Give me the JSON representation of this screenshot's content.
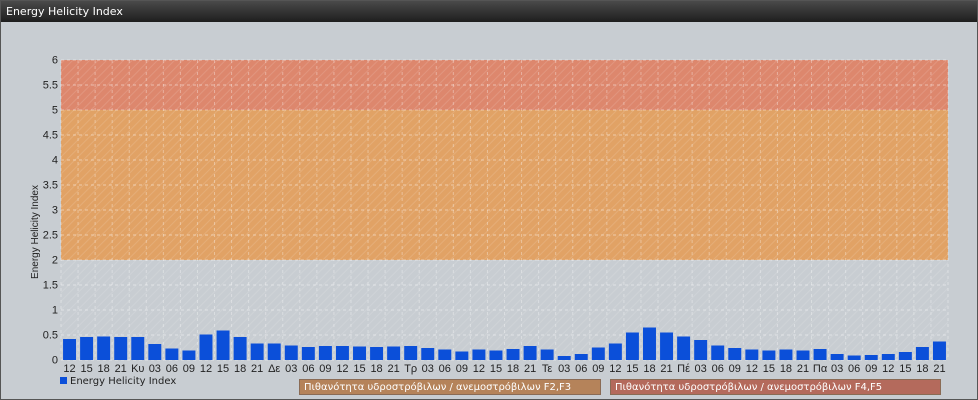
{
  "window": {
    "title": "Energy Helicity Index"
  },
  "legend": {
    "series_label": "Energy Helicity Index",
    "series_color": "#0b4fd9"
  },
  "bands": [
    {
      "from": 2,
      "to": 5,
      "label": "Πιθανότητα υδροστρόβιλων / ανεμοστρόβιλων F2,F3",
      "color": "#e59a52",
      "label_color": "#b5835a"
    },
    {
      "from": 5,
      "to": 6,
      "label": "Πιθανότητα υδροστρόβιλων / ανεμοστρόβιλων F4,F5",
      "color": "#e07a5c",
      "label_color": "#b46a5c"
    }
  ],
  "chart_data": {
    "type": "bar",
    "ylabel": "Energy Helicity Index",
    "ylim": [
      0,
      6
    ],
    "yticks": [
      0,
      0.5,
      1,
      1.5,
      2,
      2.5,
      3,
      3.5,
      4,
      4.5,
      5,
      5.5,
      6
    ],
    "categories": [
      "12",
      "15",
      "18",
      "21",
      "Κυ",
      "03",
      "06",
      "09",
      "12",
      "15",
      "18",
      "21",
      "Δε",
      "03",
      "06",
      "09",
      "12",
      "15",
      "18",
      "21",
      "Τρ",
      "03",
      "06",
      "09",
      "12",
      "15",
      "18",
      "21",
      "Τε",
      "03",
      "06",
      "09",
      "12",
      "15",
      "18",
      "21",
      "Πέ",
      "03",
      "06",
      "09",
      "12",
      "15",
      "18",
      "21",
      "Πα",
      "03",
      "06",
      "09",
      "12",
      "15",
      "18",
      "21"
    ],
    "series": [
      {
        "name": "Energy Helicity Index",
        "values": [
          0.42,
          0.46,
          0.47,
          0.46,
          0.46,
          0.32,
          0.23,
          0.19,
          0.51,
          0.59,
          0.46,
          0.33,
          0.33,
          0.29,
          0.26,
          0.28,
          0.28,
          0.27,
          0.26,
          0.27,
          0.28,
          0.24,
          0.21,
          0.17,
          0.21,
          0.19,
          0.22,
          0.28,
          0.21,
          0.08,
          0.12,
          0.25,
          0.33,
          0.55,
          0.65,
          0.55,
          0.47,
          0.4,
          0.29,
          0.24,
          0.21,
          0.19,
          0.21,
          0.19,
          0.22,
          0.12,
          0.09,
          0.1,
          0.12,
          0.16,
          0.26,
          0.37
        ]
      }
    ]
  }
}
